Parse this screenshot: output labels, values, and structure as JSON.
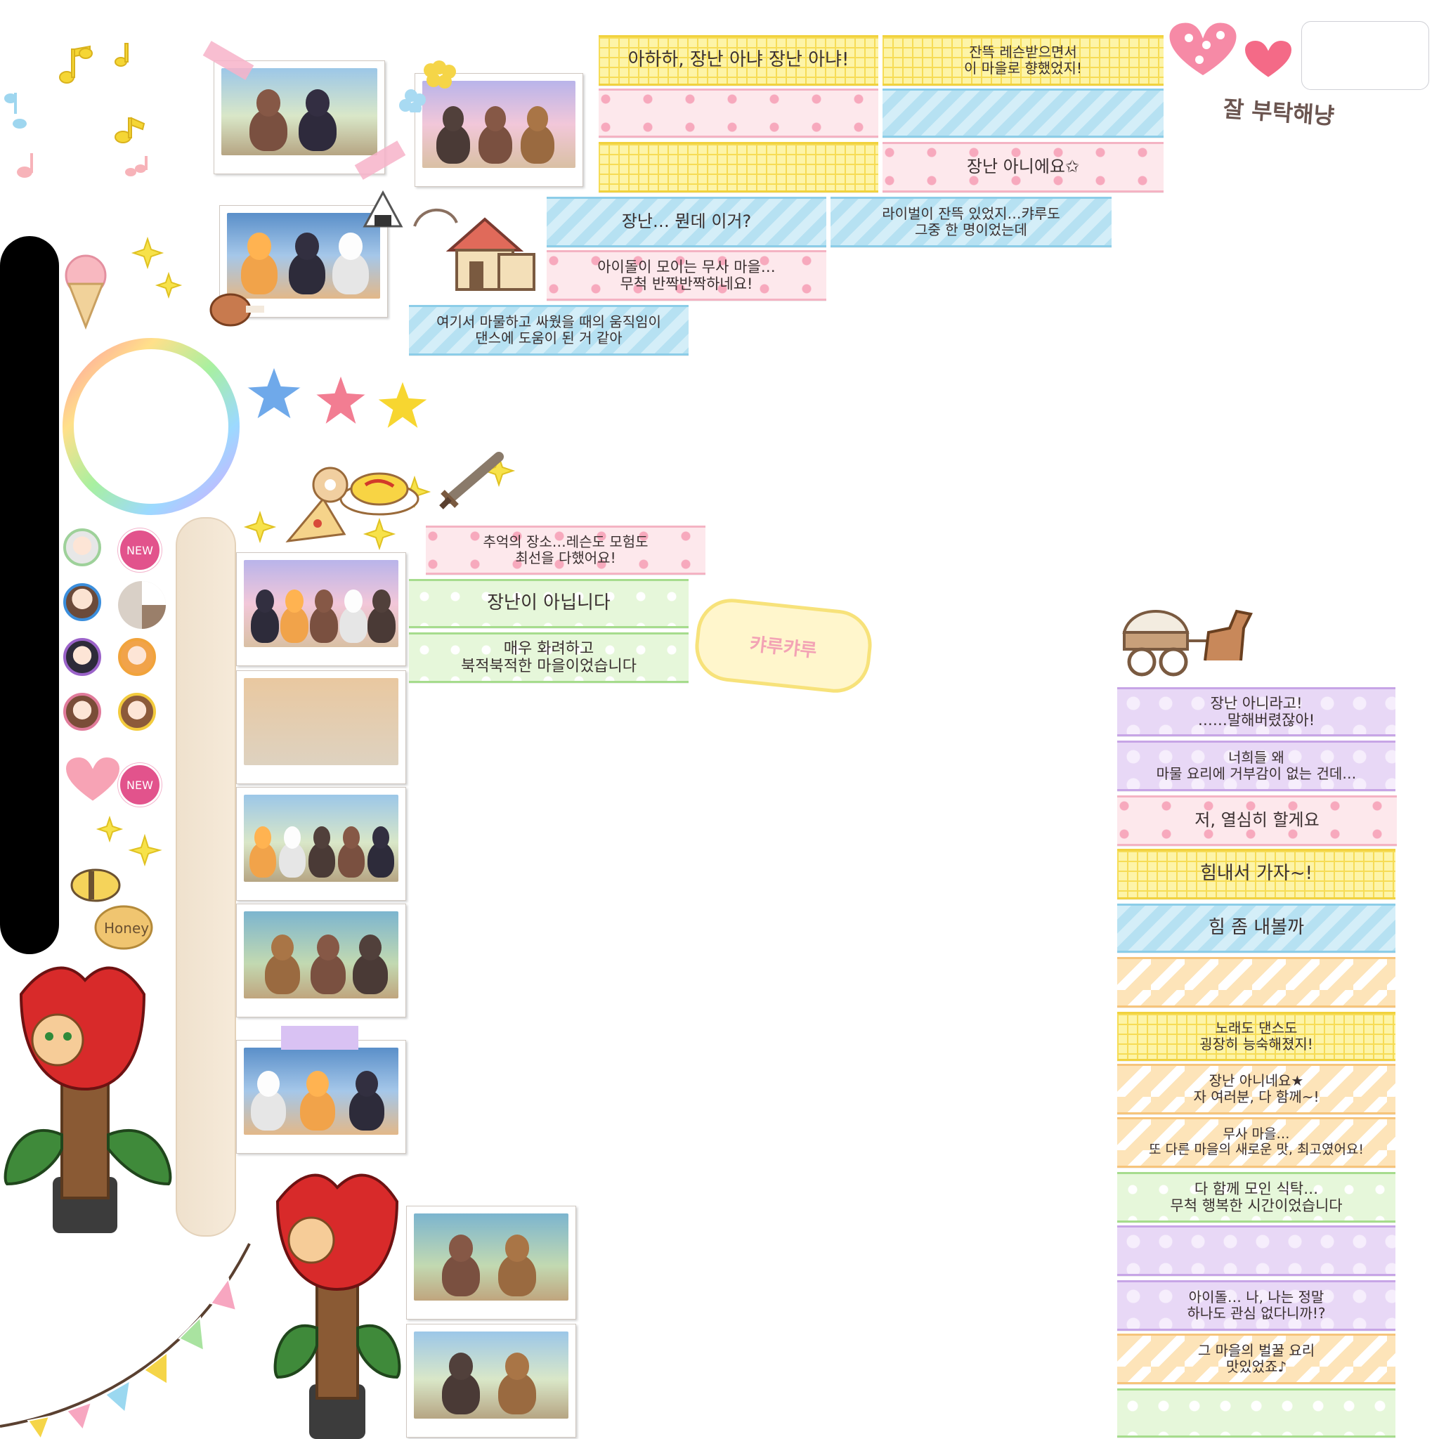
{
  "tapes": {
    "t1": "아하하, 장난 아냐 장난 아냐!",
    "t2": "잔뜩 레슨받으면서\n이 마을로 향했었지!",
    "t3": "",
    "t4": "",
    "t5": "",
    "t6": "장난 아니에요✩",
    "t7": "장난… 뭔데 이거?",
    "t8": "라이벌이 잔뜩 있었지…캬루도\n그중 한 명이었는데",
    "t9": "아이돌이 모이는 무사 마을…\n무척 반짝반짝하네요!",
    "t10": "여기서 마물하고 싸웠을 때의 움직임이\n댄스에 도움이 된 거 같아",
    "t11": "추억의 장소…레슨도 모험도\n최선을 다했어요!",
    "t12": "장난이 아닙니다",
    "t13": "매우 화려하고\n북적북적한 마을이었습니다",
    "r1": "장난 아니라고!\n……말해버렸잖아!",
    "r2": "너희들 왜\n마물 요리에 거부감이 없는 건데…",
    "r3": "저, 열심히 할게요",
    "r4": "힘내서 가자~!",
    "r5": "힘 좀 내볼까",
    "r6": "",
    "r7": "노래도 댄스도\n굉장히 능숙해졌지!",
    "r8": "장난 아니네요★\n자 여러분, 다 함께~!",
    "r9": "무사 마을…\n또 다른 마을의 새로운 맛, 최고였어요!",
    "r10": "다 함께 모인 식탁…\n무척 행복한 시간이었습니다",
    "r11": "",
    "r12": "아이돌… 나, 나는 정말\n하나도 관심 없다니까!?",
    "r13": "그 마을의 벌꿀 요리\n맛있었죠♪",
    "r14": ""
  },
  "stickers": {
    "greeting": "잘 부탁해냥",
    "karyu": "캬루캬루",
    "honey": "Honey",
    "new1": "NEW",
    "new2": "NEW"
  },
  "colors": {
    "yellow": "#fdf4a8",
    "pink": "#fde8ec",
    "blue": "#c5e8f5",
    "green": "#e6f7da",
    "purple": "#e8d8f6",
    "orange": "#fde4b9",
    "accent_pink": "#e2538c"
  },
  "icons": [
    "music-note-icon",
    "heart-icon",
    "star-face-icon",
    "sparkle-icon",
    "ice-cream-icon",
    "onigiri-icon",
    "meat-icon",
    "house-icon",
    "pizza-icon",
    "omelette-icon",
    "sword-icon",
    "bee-icon",
    "carriage-icon",
    "tulip-post-icon",
    "bunting-icon",
    "rainbow-ring-icon",
    "clock-pie-icon"
  ]
}
